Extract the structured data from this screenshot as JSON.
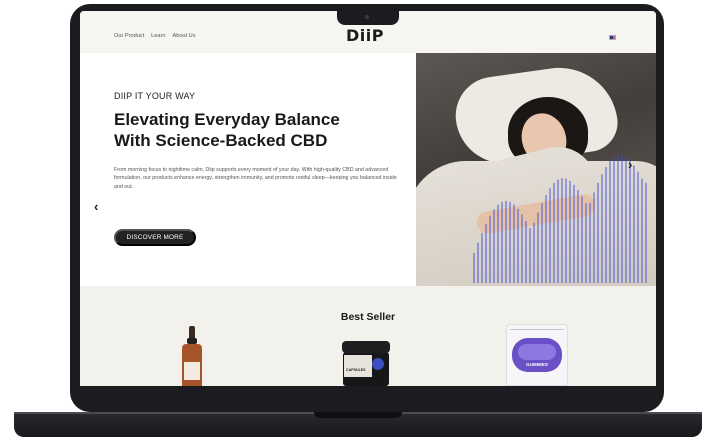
{
  "nav": {
    "links": [
      "Our Product",
      "Learn",
      "About Us"
    ]
  },
  "brand": {
    "logo": "DiiP"
  },
  "hero": {
    "eyebrow": "DIIP IT YOUR WAY",
    "headline_line1": "Elevating Everyday Balance",
    "headline_line2": "With Science-Backed CBD",
    "body": "From morning focus to nighttime calm, Diip supports every moment of your day. With high-quality CBD and advanced formulation, our products enhance energy, strengthen immunity, and promote restful sleep—keeping you balanced inside and out.",
    "cta_label": "DISCOVER MORE",
    "prev_arrow": "‹",
    "next_arrow": "›",
    "accent_color": "#3f4ed6"
  },
  "bestseller": {
    "title": "Best Seller",
    "products": [
      {
        "icon": "tincture-bottle-icon"
      },
      {
        "icon": "capsule-jar-icon",
        "label": "CAPSULES"
      },
      {
        "icon": "gummies-pouch-icon",
        "label": "GUMMIES"
      }
    ]
  }
}
